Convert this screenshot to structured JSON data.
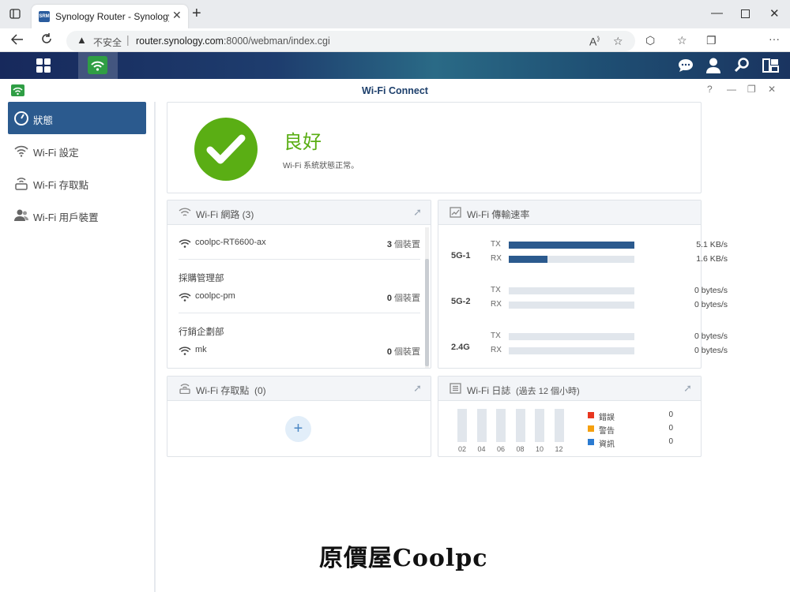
{
  "browser": {
    "tab_title": "Synology Router - SynologyRouter",
    "tab_favicon": "SRM",
    "not_secure": "不安全",
    "url_host": "router.synology.com",
    "url_rest": ":8000/webman/index.cgi"
  },
  "app": {
    "title": "Wi-Fi Connect"
  },
  "sidebar": {
    "items": [
      {
        "label": "狀態",
        "icon": "gauge-icon"
      },
      {
        "label": "Wi-Fi 設定",
        "icon": "wifi-icon"
      },
      {
        "label": "Wi-Fi 存取點",
        "icon": "router-icon"
      },
      {
        "label": "Wi-Fi 用戶裝置",
        "icon": "users-icon"
      }
    ]
  },
  "status": {
    "title": "良好",
    "desc": "Wi-Fi 系統狀態正常。"
  },
  "networks": {
    "title": "Wi-Fi 網路",
    "count": "(3)",
    "groups": [
      {
        "name": "",
        "ssid": "coolpc-RT6600-ax",
        "devices": "3",
        "unit": "個裝置"
      },
      {
        "name": "採購管理部",
        "ssid": "coolpc-pm",
        "devices": "0",
        "unit": "個裝置"
      },
      {
        "name": "行銷企劃部",
        "ssid": "mk",
        "devices": "0",
        "unit": "個裝置"
      }
    ]
  },
  "speed": {
    "title": "Wi-Fi 傳輸速率",
    "tx": "TX",
    "rx": "RX",
    "bands": [
      {
        "name": "5G-1",
        "tx": "5.1 KB/s",
        "rx": "1.6 KB/s",
        "tx_level": 1.0,
        "rx_level": 0.31
      },
      {
        "name": "5G-2",
        "tx": "0 bytes/s",
        "rx": "0 bytes/s",
        "tx_level": 0,
        "rx_level": 0
      },
      {
        "name": "2.4G",
        "tx": "0 bytes/s",
        "rx": "0 bytes/s",
        "tx_level": 0,
        "rx_level": 0
      }
    ]
  },
  "access_points": {
    "title": "Wi-Fi 存取點",
    "count": "(0)",
    "add": "+"
  },
  "log": {
    "title": "Wi-Fi 日誌",
    "subtitle": "(過去 12 個小時)",
    "hours": [
      "02",
      "04",
      "06",
      "08",
      "10",
      "12"
    ],
    "legend": [
      {
        "label": "錯誤",
        "value": "0",
        "color": "#e8361f"
      },
      {
        "label": "警告",
        "value": "0",
        "color": "#f5a00f"
      },
      {
        "label": "資訊",
        "value": "0",
        "color": "#2b7bd1"
      }
    ]
  },
  "watermark": "原價屋Coolpc"
}
